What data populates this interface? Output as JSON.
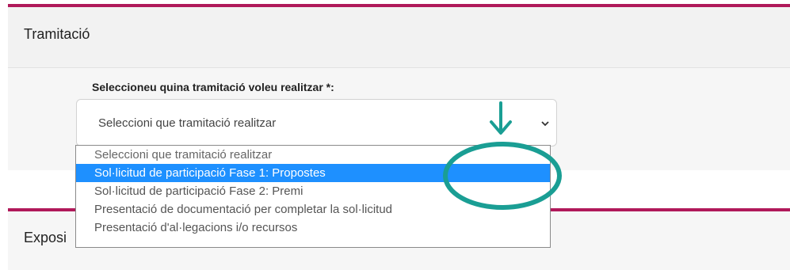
{
  "section_tramitacio": {
    "title": "Tramitació",
    "field_label": "Seleccioneu quina tramitació voleu realitzar *:",
    "select_value": "Seleccioni que tramitació realitzar"
  },
  "dropdown": {
    "options": [
      {
        "label": "Seleccioni que tramitació realitzar",
        "selected": false
      },
      {
        "label": "Sol·licitud de participació Fase 1: Propostes",
        "selected": true
      },
      {
        "label": "Sol·licitud de participació Fase 2: Premi",
        "selected": false
      },
      {
        "label": "Presentació de documentació per completar la sol·licitud",
        "selected": false
      },
      {
        "label": "Presentació d'al·legacions i/o recursos",
        "selected": false
      }
    ]
  },
  "section_exposicio": {
    "title": "Exposi"
  },
  "colors": {
    "accent": "#b0195a",
    "highlight": "#1e90ff",
    "annotation": "#1a9e94"
  },
  "icons": {
    "select_chevron": "chevron-down-icon",
    "annotation_arrow": "arrow-down-icon",
    "annotation_ellipse": "highlight-ellipse"
  }
}
